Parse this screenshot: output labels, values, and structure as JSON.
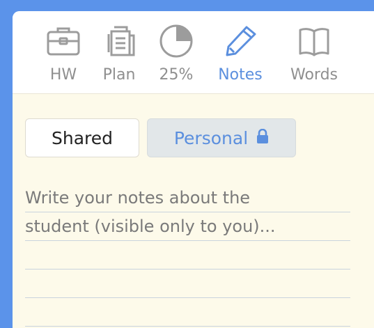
{
  "toolbar": {
    "tabs": [
      {
        "label": "HW",
        "icon": "briefcase-icon"
      },
      {
        "label": "Plan",
        "icon": "document-stack-icon"
      },
      {
        "label": "25%",
        "icon": "progress-ring-icon",
        "progress": 0.25
      },
      {
        "label": "Notes",
        "icon": "pencil-icon",
        "active": true
      },
      {
        "label": "Words",
        "icon": "open-book-icon"
      }
    ]
  },
  "segmented": {
    "shared_label": "Shared",
    "personal_label": "Personal",
    "personal_icon": "lock-icon",
    "selected": "Personal"
  },
  "notes": {
    "placeholder_line1": "Write your notes about the",
    "placeholder_line2": "student (visible only to you)..."
  },
  "colors": {
    "background": "#5b93ea",
    "panel": "#fdfaea",
    "accent": "#5b8fde",
    "icon_gray": "#9c9c9c"
  }
}
